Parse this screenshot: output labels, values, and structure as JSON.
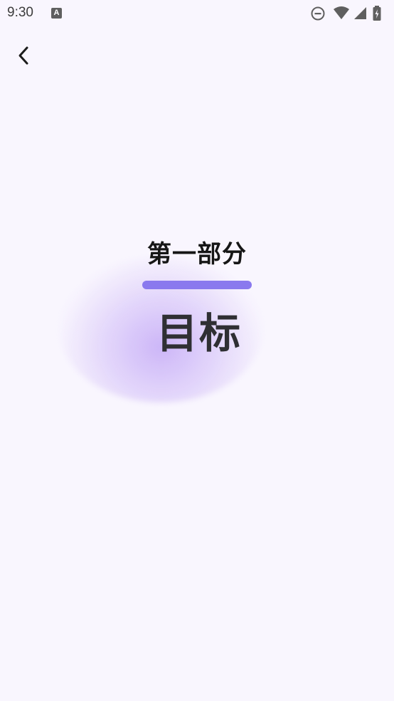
{
  "status_bar": {
    "time": "9:30",
    "app_icon_glyph": "A",
    "icons": [
      "do-not-disturb-icon",
      "wifi-icon",
      "cellular-signal-icon",
      "battery-charging-icon"
    ]
  },
  "nav": {
    "back_icon": "chevron-left-icon"
  },
  "content": {
    "section_label": "第一部分",
    "section_title": "目标"
  },
  "colors": {
    "background": "#f9f6fe",
    "accent": "#8a79ee",
    "glow": "#c4aaf6",
    "title_text": "#2f2f33"
  }
}
